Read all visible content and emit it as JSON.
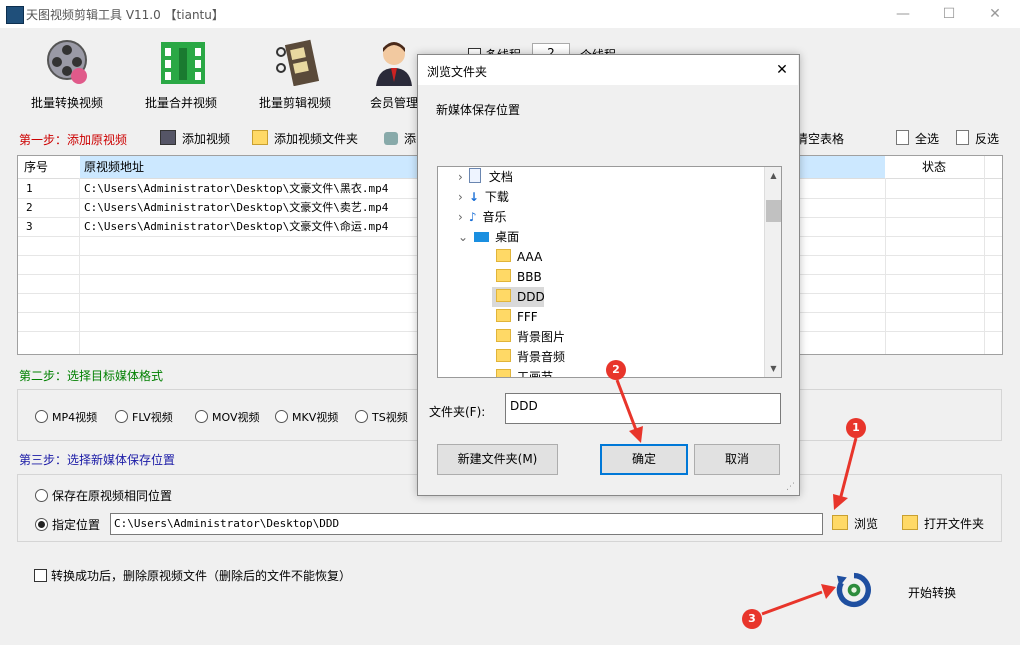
{
  "window": {
    "title": "天图视频剪辑工具 V11.0 【tiantu】",
    "minimize": "—",
    "maximize": "☐",
    "close": "✕"
  },
  "toolbar": {
    "batch_convert": "批量转换视频",
    "batch_merge": "批量合并视频",
    "batch_edit": "批量剪辑视频",
    "member": "会员管理",
    "multi_thread": "多线程",
    "thread_count": "2",
    "thread_unit": "个线程"
  },
  "step1": {
    "label": "第一步：添加原视频",
    "add_video": "添加视频",
    "add_folder": "添加视频文件夹",
    "add_other": "添",
    "clear_table": "清空表格",
    "select_all": "全选",
    "invert": "反选"
  },
  "table": {
    "headers": {
      "index": "序号",
      "path": "原视频地址",
      "status": "状态"
    },
    "rows": [
      {
        "index": "1",
        "path": "C:\\Users\\Administrator\\Desktop\\文豪文件\\黑衣.mp4"
      },
      {
        "index": "2",
        "path": "C:\\Users\\Administrator\\Desktop\\文豪文件\\卖艺.mp4"
      },
      {
        "index": "3",
        "path": "C:\\Users\\Administrator\\Desktop\\文豪文件\\命运.mp4"
      }
    ]
  },
  "step2": {
    "label": "第二步：选择目标媒体格式",
    "formats": [
      "MP4视频",
      "FLV视频",
      "MOV视频",
      "MKV视频",
      "TS视频"
    ]
  },
  "step3": {
    "label": "第三步：选择新媒体保存位置",
    "same_location": "保存在原视频相同位置",
    "specify": "指定位置",
    "path": "C:\\Users\\Administrator\\Desktop\\DDD",
    "browse": "浏览",
    "open_folder": "打开文件夹"
  },
  "delete_after": "转换成功后，删除原视频文件（删除后的文件不能恢复）",
  "start_convert": "开始转换",
  "dialog": {
    "title": "浏览文件夹",
    "close": "✕",
    "prompt": "新媒体保存位置",
    "tree": {
      "documents": "文档",
      "downloads": "下载",
      "music": "音乐",
      "desktop": "桌面",
      "folders": [
        "AAA",
        "BBB",
        "DDD",
        "FFF",
        "背景图片",
        "背景音频",
        "工画节"
      ]
    },
    "folder_label": "文件夹(F):",
    "folder_value": "DDD",
    "new_folder": "新建文件夹(M)",
    "ok": "确定",
    "cancel": "取消"
  },
  "markers": {
    "m1": "1",
    "m2": "2",
    "m3": "3"
  },
  "colors": {
    "step_red": "#cc0000",
    "step_green": "#008000",
    "step_blue": "#1a1aa6",
    "marker": "#e8352b",
    "selection": "#cce8ff"
  }
}
